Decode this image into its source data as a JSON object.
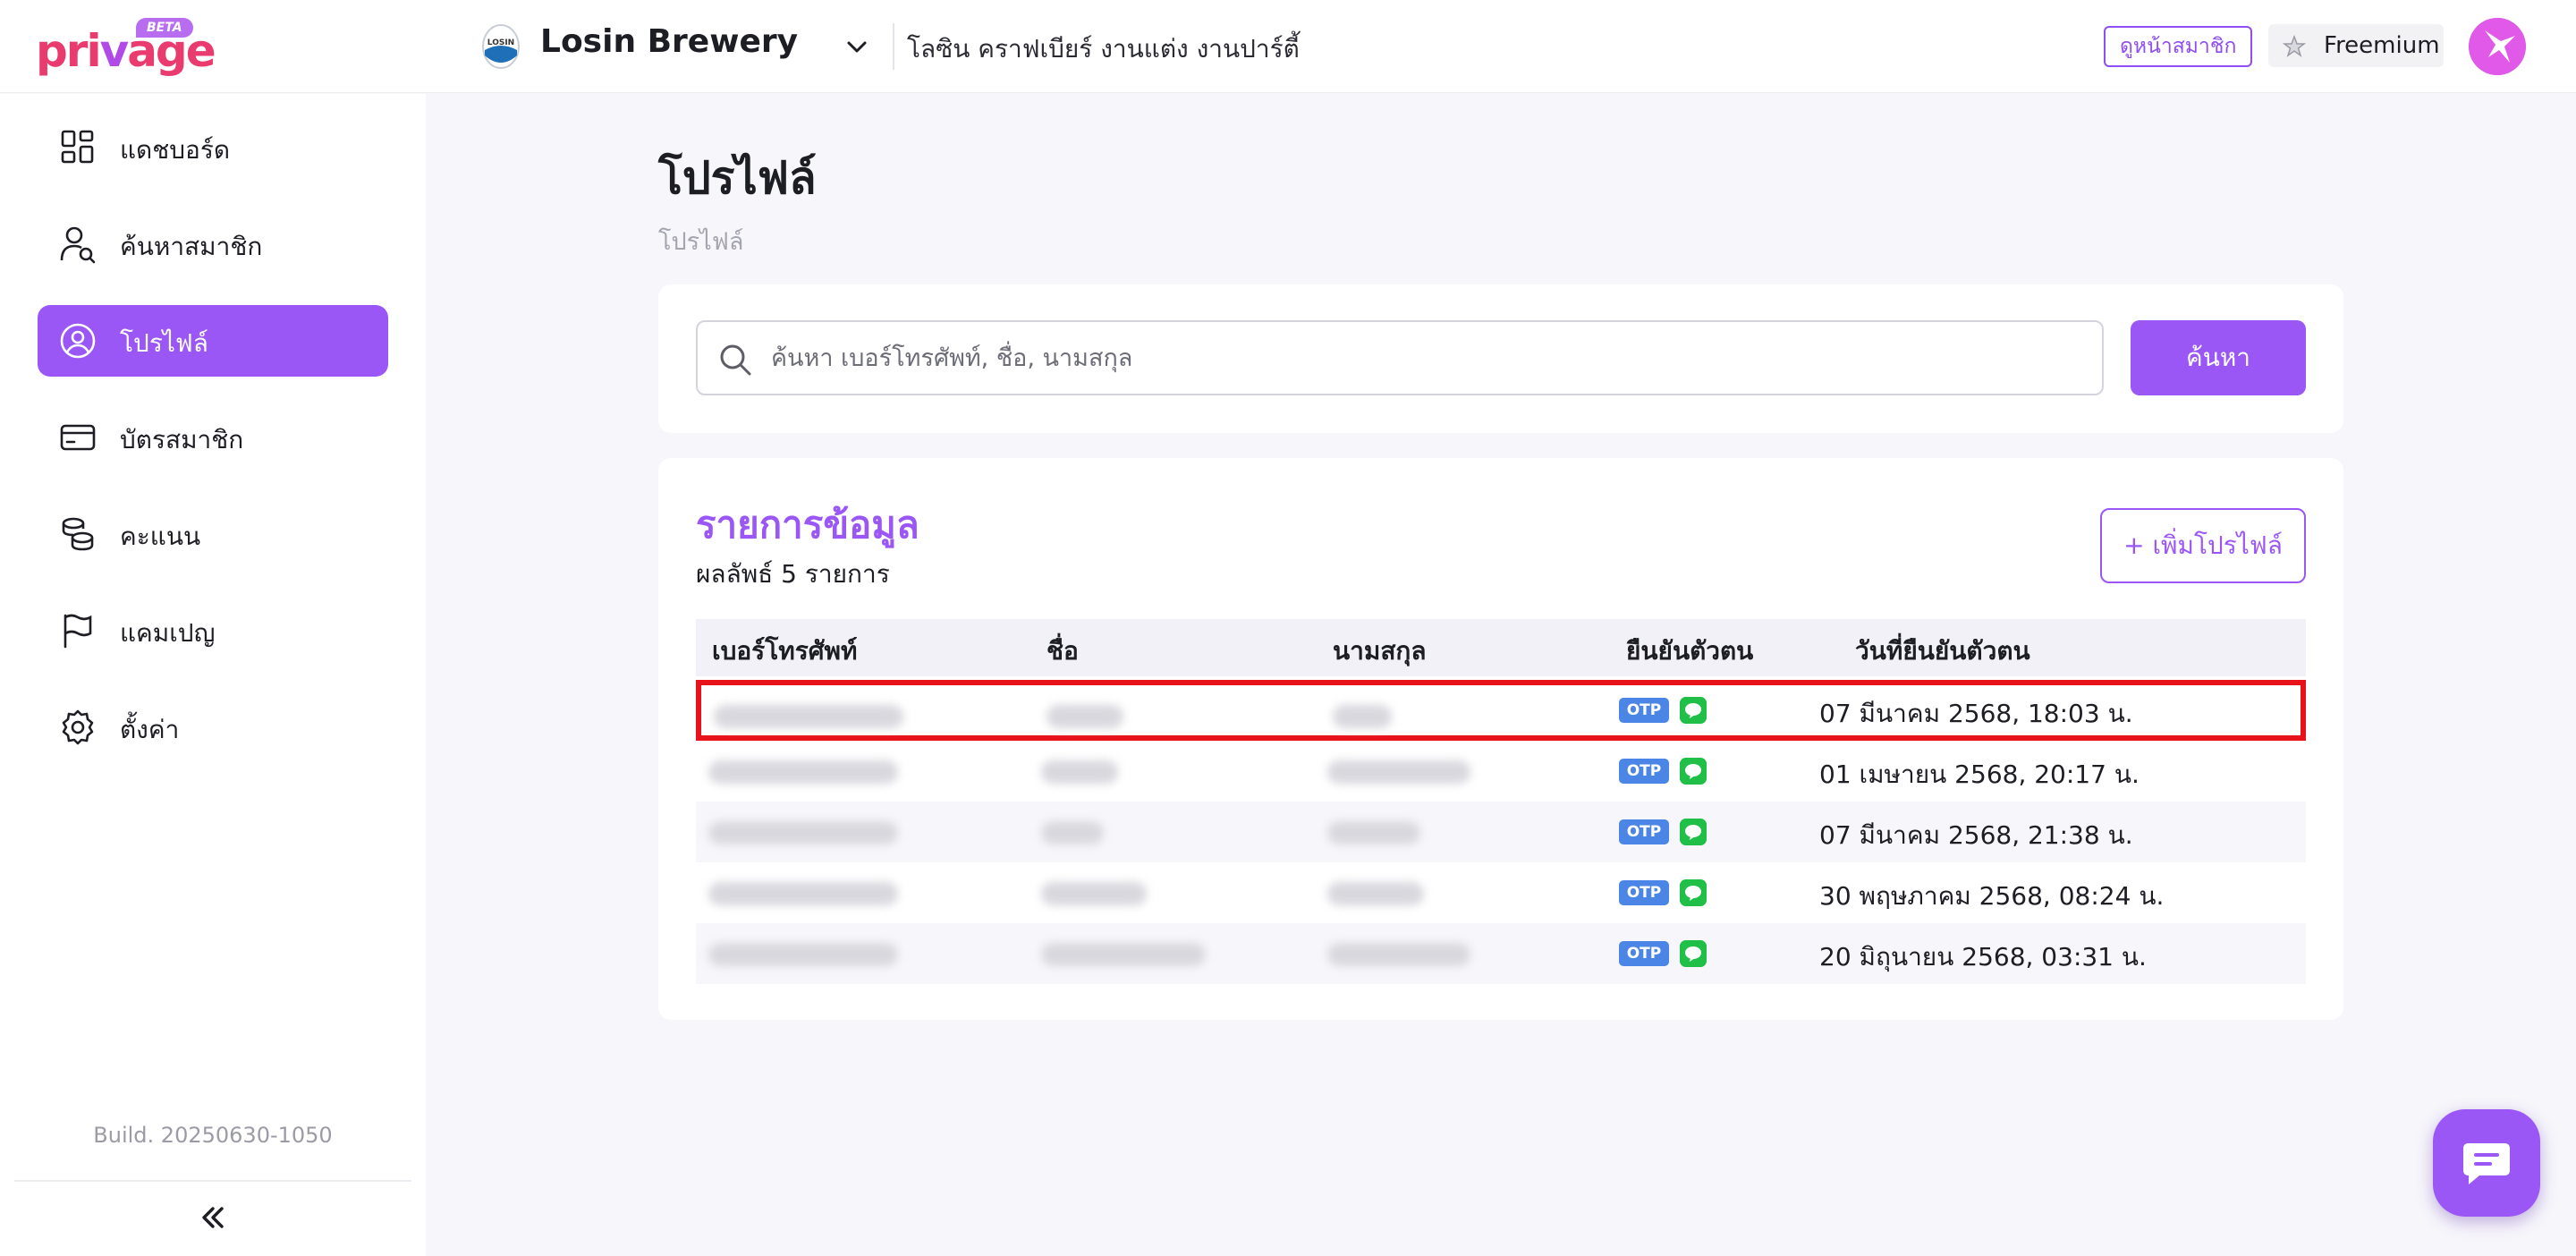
{
  "header": {
    "logo_text_a": "pri",
    "logo_text_b": "v",
    "logo_text_c": "age",
    "logo_badge": "BETA",
    "brand_name": "Losin Brewery",
    "brand_description": "โลซิน คราฟเบียร์ งานแต่ง งานปาร์ตี้",
    "member_page_link": "ดูหน้าสมาชิก",
    "plan_label": "Freemium"
  },
  "sidebar": {
    "items": [
      {
        "label": "แดชบอร์ด",
        "icon": "dashboard-icon"
      },
      {
        "label": "ค้นหาสมาชิก",
        "icon": "search-member-icon"
      },
      {
        "label": "โปรไฟล์",
        "icon": "profile-icon",
        "active": true
      },
      {
        "label": "บัตรสมาชิก",
        "icon": "member-card-icon"
      },
      {
        "label": "คะแนน",
        "icon": "points-icon"
      },
      {
        "label": "แคมเปญ",
        "icon": "flag-icon"
      },
      {
        "label": "ตั้งค่า",
        "icon": "gear-icon"
      }
    ],
    "build": "Build. 20250630-1050"
  },
  "main": {
    "title": "โปรไฟล์",
    "breadcrumb": "โปรไฟล์",
    "search": {
      "placeholder": "ค้นหา เบอร์โทรศัพท์, ชื่อ, นามสกุล",
      "value": "",
      "button": "ค้นหา"
    },
    "list": {
      "title": "รายการข้อมูล",
      "count_text": "ผลลัพธ์ 5 รายการ",
      "add_button": "+ เพิ่มโปรไฟล์",
      "columns": [
        "เบอร์โทรศัพท์",
        "ชื่อ",
        "นามสกุล",
        "ยืนยันตัวตน",
        "วันที่ยืนยันตัวตน"
      ],
      "rows": [
        {
          "otp": "OTP",
          "date": "07 มีนาคม 2568, 18:03 น.",
          "selected": true
        },
        {
          "otp": "OTP",
          "date": "01 เมษายน 2568, 20:17 น."
        },
        {
          "otp": "OTP",
          "date": "07 มีนาคม 2568, 21:38 น."
        },
        {
          "otp": "OTP",
          "date": "30 พฤษภาคม 2568, 08:24 น."
        },
        {
          "otp": "OTP",
          "date": "20 มิถุนายน 2568, 03:31 น."
        }
      ]
    }
  },
  "colors": {
    "accent": "#9b57f5",
    "selection_outline": "#e8121b",
    "otp_badge": "#4b86e6",
    "line_green": "#1fbf48"
  }
}
